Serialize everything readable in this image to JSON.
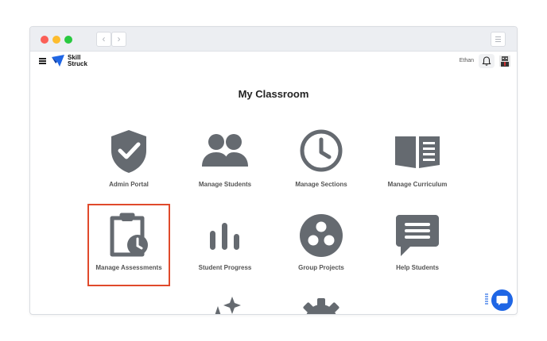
{
  "browser": {
    "back_label": "‹",
    "forward_label": "›"
  },
  "app": {
    "logo_text_line1": "Skill",
    "logo_text_line2": "Struck",
    "user_name": "Ethan"
  },
  "main": {
    "title": "My Classroom",
    "tiles": [
      {
        "label": "Admin Portal",
        "icon": "shield-check-icon"
      },
      {
        "label": "Manage Students",
        "icon": "users-icon"
      },
      {
        "label": "Manage Sections",
        "icon": "clock-icon"
      },
      {
        "label": "Manage Curriculum",
        "icon": "book-icon"
      },
      {
        "label": "Manage Assessments",
        "icon": "clipboard-clock-icon",
        "selected": true
      },
      {
        "label": "Student Progress",
        "icon": "bar-chart-icon"
      },
      {
        "label": "Group Projects",
        "icon": "group-circle-icon"
      },
      {
        "label": "Help Students",
        "icon": "chat-bubble-icon"
      },
      {
        "label": "",
        "icon": "sparkles-icon"
      },
      {
        "label": "",
        "icon": "gear-icon"
      }
    ]
  },
  "colors": {
    "icon_gray": "#656a70",
    "highlight": "#e04a2b",
    "brand_blue": "#1f66e5"
  }
}
